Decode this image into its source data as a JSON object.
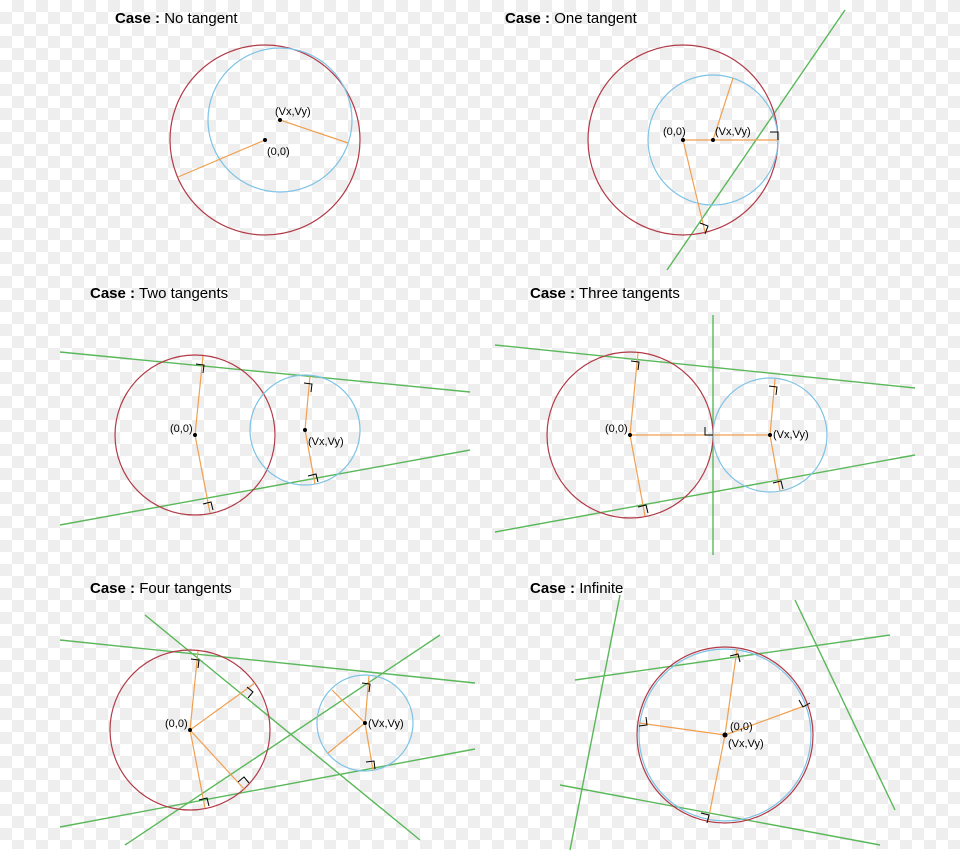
{
  "cases": [
    {
      "id": "no-tangent",
      "title_pre": "Case :",
      "title_main": "No tangent",
      "origin_label": "(0,0)",
      "v_label": "(Vx,Vy)"
    },
    {
      "id": "one-tangent",
      "title_pre": "Case :",
      "title_main": "One tangent",
      "origin_label": "(0,0)",
      "v_label": "(Vx,Vy)"
    },
    {
      "id": "two-tangents",
      "title_pre": "Case :",
      "title_main": "Two tangents",
      "origin_label": "(0,0)",
      "v_label": "(Vx,Vy)"
    },
    {
      "id": "three-tangents",
      "title_pre": "Case :",
      "title_main": "Three tangents",
      "origin_label": "(0,0)",
      "v_label": "(Vx,Vy)"
    },
    {
      "id": "four-tangents",
      "title_pre": "Case :",
      "title_main": "Four tangents",
      "origin_label": "(0,0)",
      "v_label": "(Vx,Vy)"
    },
    {
      "id": "infinite",
      "title_pre": "Case :",
      "title_main": "Infinite",
      "origin_label": "(0,0)",
      "v_label": "(Vx,Vy)"
    }
  ]
}
